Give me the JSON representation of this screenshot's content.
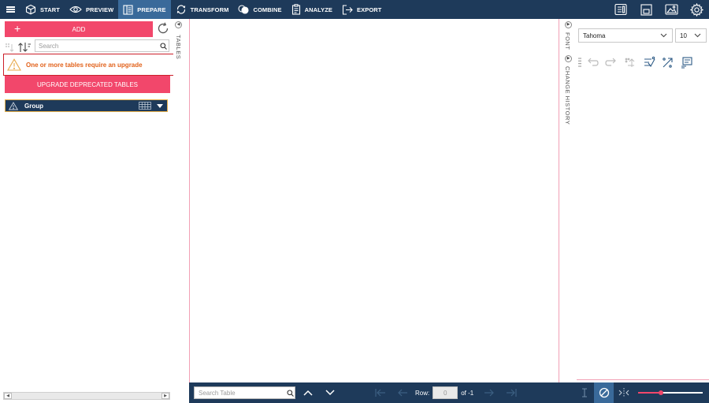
{
  "nav": {
    "items": [
      {
        "label": "START",
        "icon": "cube-icon",
        "active": false
      },
      {
        "label": "PREVIEW",
        "icon": "eye-icon",
        "active": false
      },
      {
        "label": "PREPARE",
        "icon": "prepare-icon",
        "active": true
      },
      {
        "label": "TRANSFORM",
        "icon": "transform-icon",
        "active": false
      },
      {
        "label": "COMBINE",
        "icon": "combine-icon",
        "active": false
      },
      {
        "label": "ANALYZE",
        "icon": "clipboard-icon",
        "active": false
      },
      {
        "label": "EXPORT",
        "icon": "export-icon",
        "active": false
      }
    ],
    "right_icons": [
      "report-icon",
      "save-icon",
      "image-icon",
      "gear-icon"
    ]
  },
  "tables_panel": {
    "add_label": "ADD",
    "search_placeholder": "Search",
    "warning_text": "One or more tables require an upgrade",
    "upgrade_label": "UPGRADE DEPRECATED TABLES",
    "group_label": "Group",
    "side_tab": "TABLES"
  },
  "right_panel": {
    "font_tab": "FONT",
    "history_tab": "CHANGE HISTORY",
    "font_name": "Tahoma",
    "font_size": "10"
  },
  "bottom_bar": {
    "search_placeholder": "Search Table",
    "row_label": "Row:",
    "row_value": "0",
    "of_label": "of -1",
    "zoom_level": 0.35
  },
  "colors": {
    "nav_bg": "#1e3a5a",
    "active_nav": "#3a6a9a",
    "accent": "#f2476b",
    "warning_text": "#e2621b",
    "warning_border": "#cc1f2a"
  }
}
